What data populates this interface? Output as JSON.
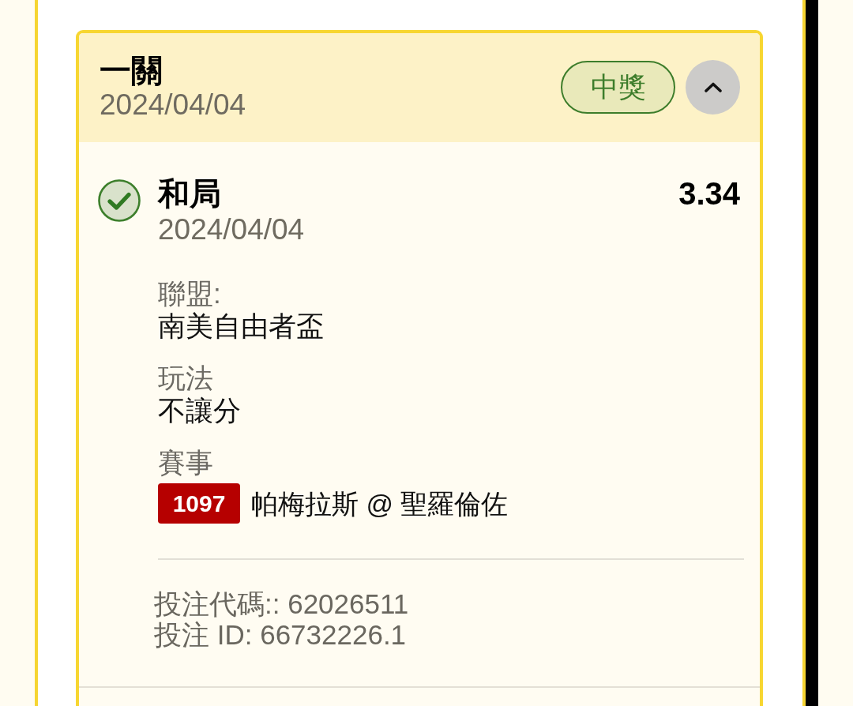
{
  "card": {
    "title": "一關",
    "date": "2024/04/04",
    "status_badge": "中獎",
    "expanded": true
  },
  "selection": {
    "won": true,
    "name": "和局",
    "odds": "3.34",
    "date": "2024/04/04",
    "details": [
      {
        "kind": "text",
        "label": "聯盟:",
        "value": "南美自由者盃"
      },
      {
        "kind": "text",
        "label": "玩法",
        "value": "不讓分"
      },
      {
        "kind": "match",
        "label": "賽事",
        "match_number": "1097",
        "value": "帕梅拉斯 @ 聖羅倫佐"
      }
    ]
  },
  "footer": [
    "投注代碼:: 62026511",
    "投注 ID: 66732226.1"
  ]
}
